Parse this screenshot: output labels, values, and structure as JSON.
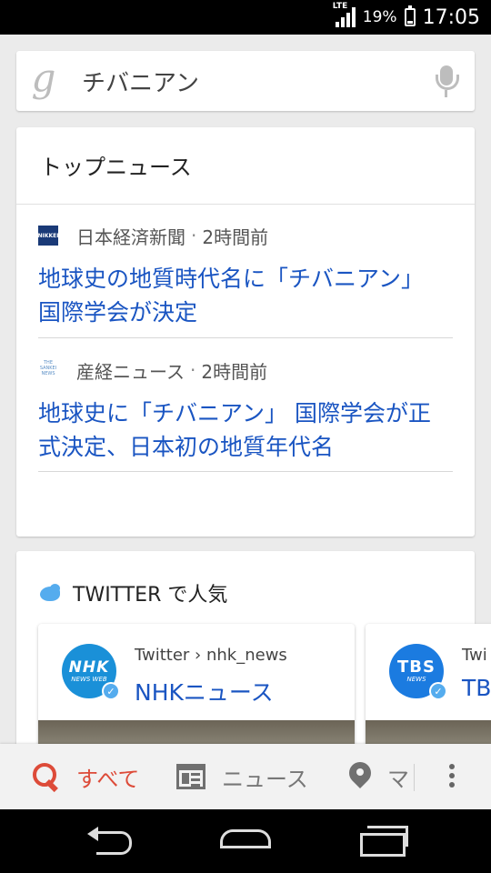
{
  "status_bar": {
    "network": "LTE",
    "battery": "19%",
    "time": "17:05"
  },
  "search": {
    "logo": "g",
    "query": "チバニアン"
  },
  "top_news": {
    "title": "トップニュース",
    "items": [
      {
        "source_icon_text": "NIKKEI",
        "source": "日本経済新聞",
        "time": "2時間前",
        "headline": "地球史の地質時代名に「チバニアン」 国際学会が決定"
      },
      {
        "source_icon_text": "THE SANKEI NEWS",
        "source": "産経ニュース",
        "time": "2時間前",
        "headline": "地球史に「チバニアン」 国際学会が正式決定、日本初の地質年代名"
      }
    ]
  },
  "twitter": {
    "title": "TWITTER で人気",
    "cards": [
      {
        "avatar_logo": "NHK",
        "avatar_sub": "NEWS WEB",
        "path": "Twitter › nhk_news",
        "name": "NHKニュース"
      },
      {
        "avatar_logo": "TBS",
        "avatar_sub": "NEWS",
        "path": "Twi",
        "name": "TB"
      }
    ]
  },
  "tabs": {
    "all": "すべて",
    "news": "ニュース",
    "maps": "マ"
  },
  "colors": {
    "accent_red": "#dd4b39",
    "link_blue": "#1a55c2",
    "twitter_blue": "#55acee"
  }
}
